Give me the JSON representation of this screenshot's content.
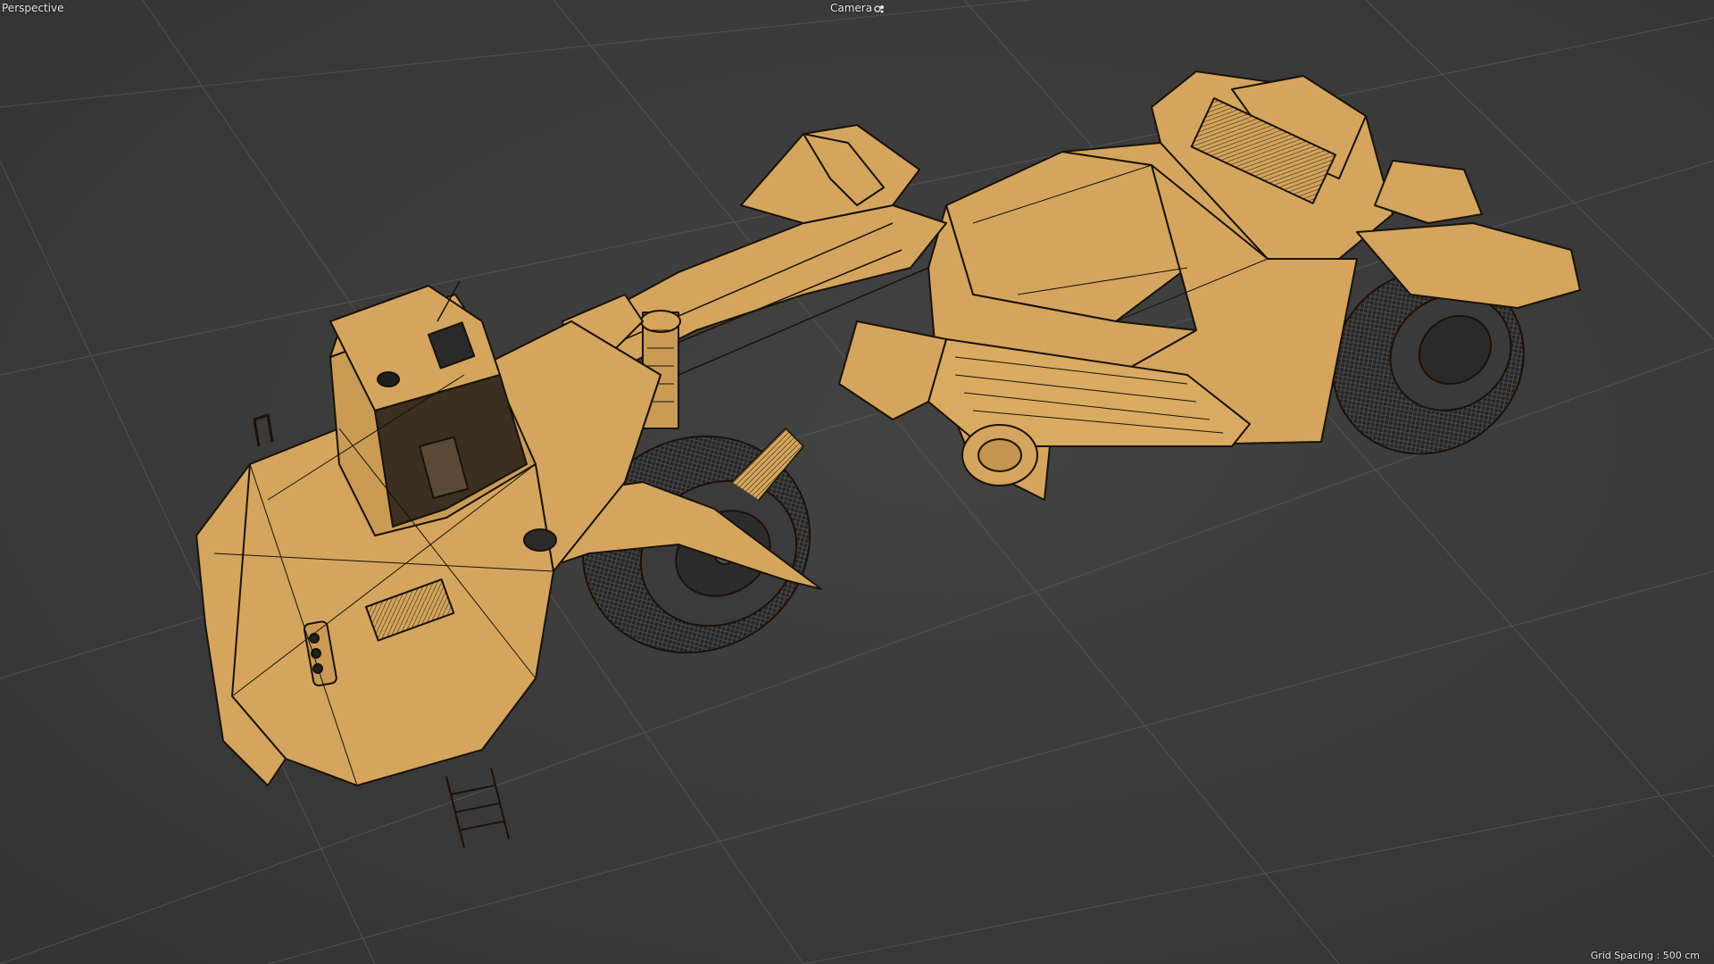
{
  "viewport": {
    "view_name": "Perspective",
    "camera_label": "Camera",
    "camera_icon": "camera-target-icon",
    "grid_spacing_text": "Grid Spacing : 500 cm"
  },
  "scene": {
    "model": "wheel tractor scraper",
    "display_mode": "shaded with wireframe",
    "colors": {
      "background": "#3b3b3b",
      "grid_lines": "#555555",
      "model_fill": "#d4a55e",
      "wireframe": "#1a1208",
      "tire": "#2a2a2a"
    }
  }
}
